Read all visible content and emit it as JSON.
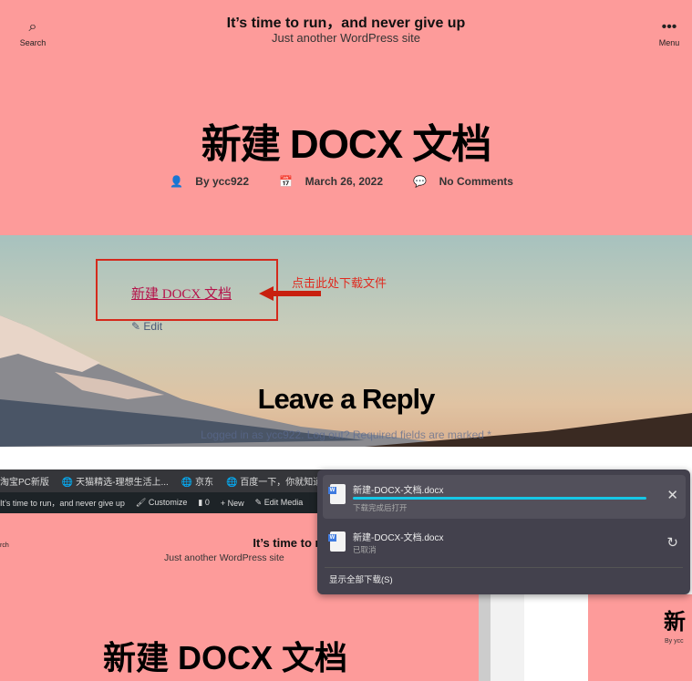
{
  "header": {
    "search_label": "Search",
    "menu_label": "Menu",
    "site_title": "It’s time to run，and never give up",
    "site_desc": "Just another WordPress site"
  },
  "post": {
    "title": "新建 DOCX 文档",
    "author": "By ycc922",
    "date": "March 26, 2022",
    "comments": "No Comments"
  },
  "content": {
    "download_link": "新建 DOCX 文档",
    "annotation": "点击此处下载文件",
    "edit": "Edit",
    "reply_heading": "Leave a Reply",
    "logged_in": "Logged in as ycc922. Log out? Required fields are marked *"
  },
  "browser": {
    "bookmarks": [
      "淘宝PC新版",
      "天猫精选-理想生活上...",
      "京东",
      "百度一下，你就知道"
    ],
    "adminbar": {
      "site": "It’s time to run，and never give up",
      "customize": "Customize",
      "comments": "0",
      "new": "New",
      "edit_media": "Edit Media"
    },
    "page": {
      "search": "rch",
      "site_title": "It’s time to run，and never give up",
      "site_desc": "Just another WordPress site",
      "post_title": "新建 DOCX 文档",
      "partial_title": "新",
      "partial_author": "By ycc"
    }
  },
  "downloads": {
    "items": [
      {
        "name": "新建-DOCX-文档.docx",
        "status": "下载完成后打开",
        "progress": 1.0,
        "action": "close-icon"
      },
      {
        "name": "新建-DOCX-文档.docx",
        "status": "已取消",
        "action": "retry-icon"
      }
    ],
    "show_all": "显示全部下载(S)",
    "accent": "#16c7e6"
  }
}
